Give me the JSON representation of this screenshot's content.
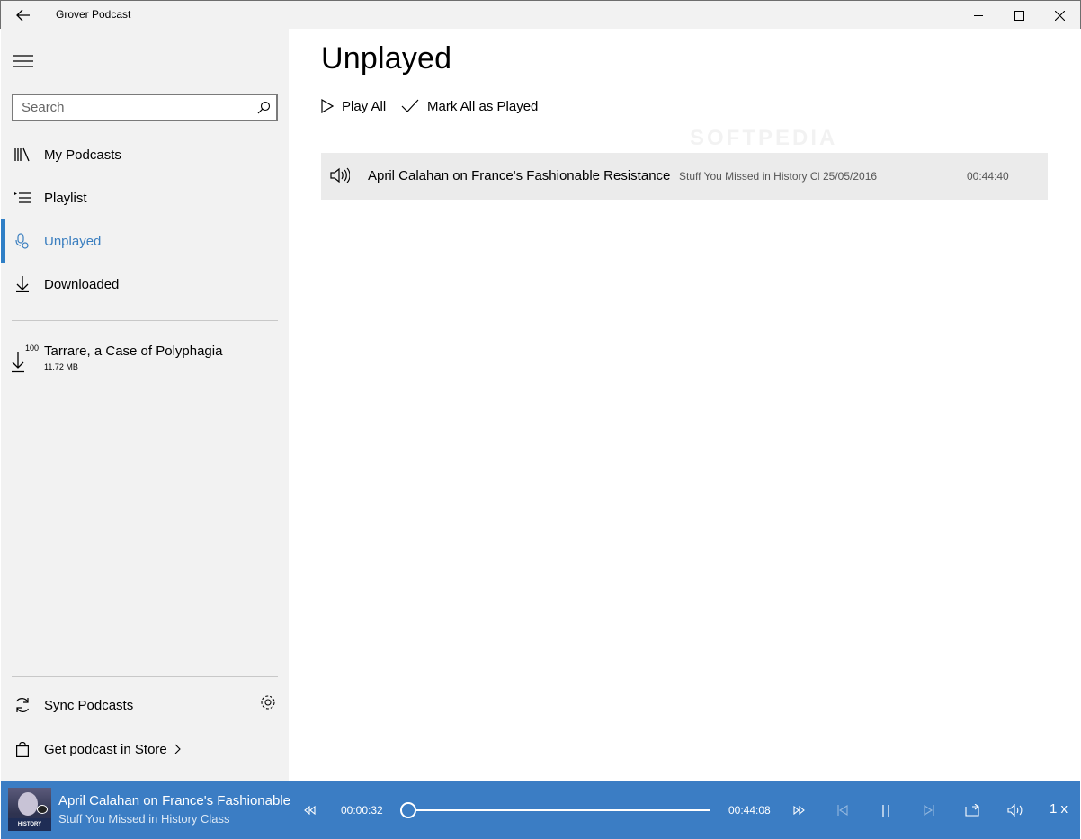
{
  "window": {
    "title": "Grover Podcast"
  },
  "sidebar": {
    "search_placeholder": "Search",
    "nav": [
      {
        "label": "My Podcasts",
        "icon": "library-icon"
      },
      {
        "label": "Playlist",
        "icon": "playlist-icon"
      },
      {
        "label": "Unplayed",
        "icon": "unplayed-icon",
        "active": true
      },
      {
        "label": "Downloaded",
        "icon": "download-icon"
      }
    ],
    "download": {
      "progress_label": "100",
      "name": "Tarrare, a Case of Polyphagia",
      "size": "11.72 MB"
    },
    "sync_label": "Sync Podcasts",
    "store_label": "Get podcast in Store"
  },
  "main": {
    "title": "Unplayed",
    "play_all_label": "Play All",
    "mark_all_label": "Mark All as Played",
    "watermark": "SOFTPEDIA",
    "episodes": [
      {
        "title": "April Calahan on France's Fashionable Resistance",
        "show": "Stuff You Missed in History Cl",
        "date": "25/05/2016",
        "duration": "00:44:40"
      }
    ]
  },
  "player": {
    "title": "April Calahan on France's Fashionable",
    "show": "Stuff You Missed in History Class",
    "art_text": "HISTORY CLASS",
    "elapsed": "00:00:32",
    "remaining": "00:44:08",
    "progress_fraction": 0.012,
    "rate": "1 x"
  },
  "colors": {
    "accent": "#3b7dc4",
    "sidebar_bg": "#f2f2f2",
    "active_text": "#3a7ebf",
    "episode_row_bg": "#ebebeb"
  }
}
